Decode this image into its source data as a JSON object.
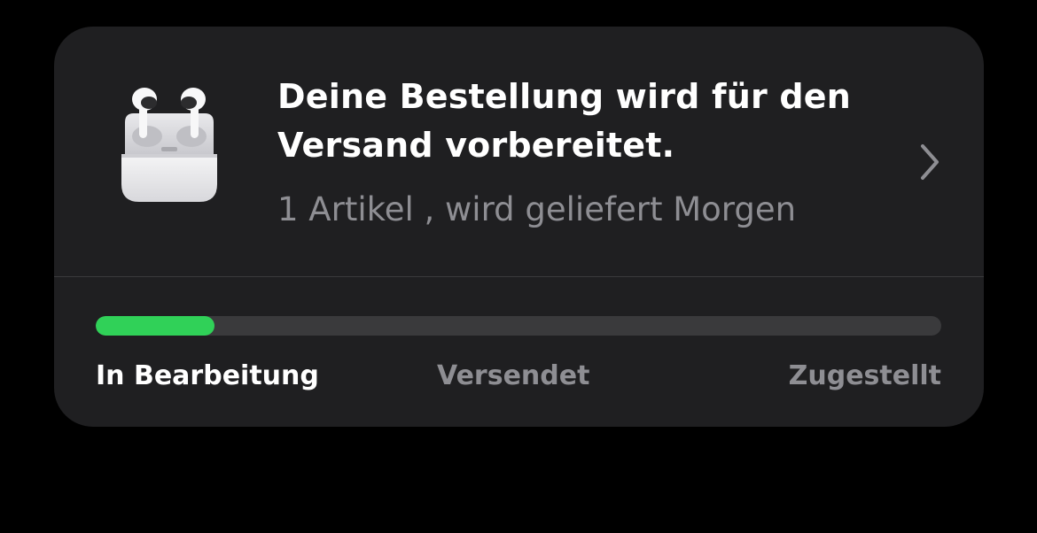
{
  "order_card": {
    "product_icon": "airpods-pro-icon",
    "title": "Deine Bestellung wird für den Versand vorbereitet.",
    "subtitle": "1 Artikel , wird geliefert Morgen",
    "chevron_icon": "chevron-right-icon"
  },
  "progress": {
    "fraction": 0.14,
    "fill_color": "#30d158",
    "track_color": "#3a3a3c",
    "steps": [
      {
        "label": "In Bearbeitung",
        "active": true
      },
      {
        "label": "Versendet",
        "active": false
      },
      {
        "label": "Zugestellt",
        "active": false
      }
    ]
  },
  "colors": {
    "background": "#000000",
    "card": "#1f1f21",
    "primary_text": "#ffffff",
    "secondary_text": "#8e8e93"
  }
}
